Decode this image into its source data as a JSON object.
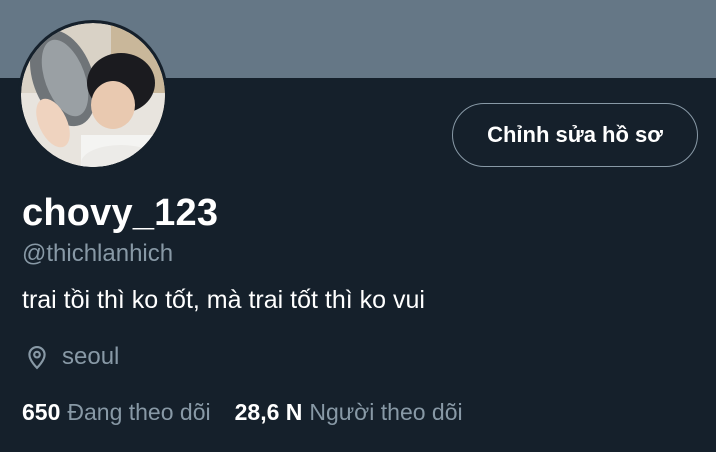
{
  "profile": {
    "display_name": "chovy_123",
    "handle": "@thichlanhich",
    "bio": "trai tồi thì ko tốt, mà trai tốt thì ko vui",
    "location": "seoul",
    "edit_button_label": "Chỉnh sửa hồ sơ"
  },
  "stats": {
    "following_count": "650",
    "following_label": "Đang theo dõi",
    "followers_count": "28,6 N",
    "followers_label": "Người theo dõi"
  },
  "icons": {
    "location": "location-pin-icon"
  },
  "colors": {
    "background": "#15202b",
    "banner": "#657786",
    "secondary_text": "#8899a6",
    "primary_text": "#ffffff"
  }
}
